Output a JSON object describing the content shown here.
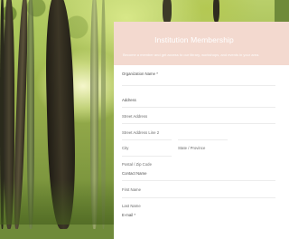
{
  "form": {
    "title": "Institution Membership",
    "subtitle": "Become a member and get access to our library, workshops, and events in your area.",
    "labels": {
      "organization_name": "Organization Name *",
      "address": "Address",
      "street_address": "Street Address",
      "street_address_2": "Street Address Line 2",
      "city": "City",
      "state_province": "State / Province",
      "postal_zip": "Postal / Zip Code",
      "contact_name": "Contact Name",
      "first_name": "First Name",
      "last_name": "Last Name",
      "email": "E-mail *"
    }
  },
  "colors": {
    "header_bg": "#f3d9cf",
    "panel_bg": "#ffffff"
  }
}
